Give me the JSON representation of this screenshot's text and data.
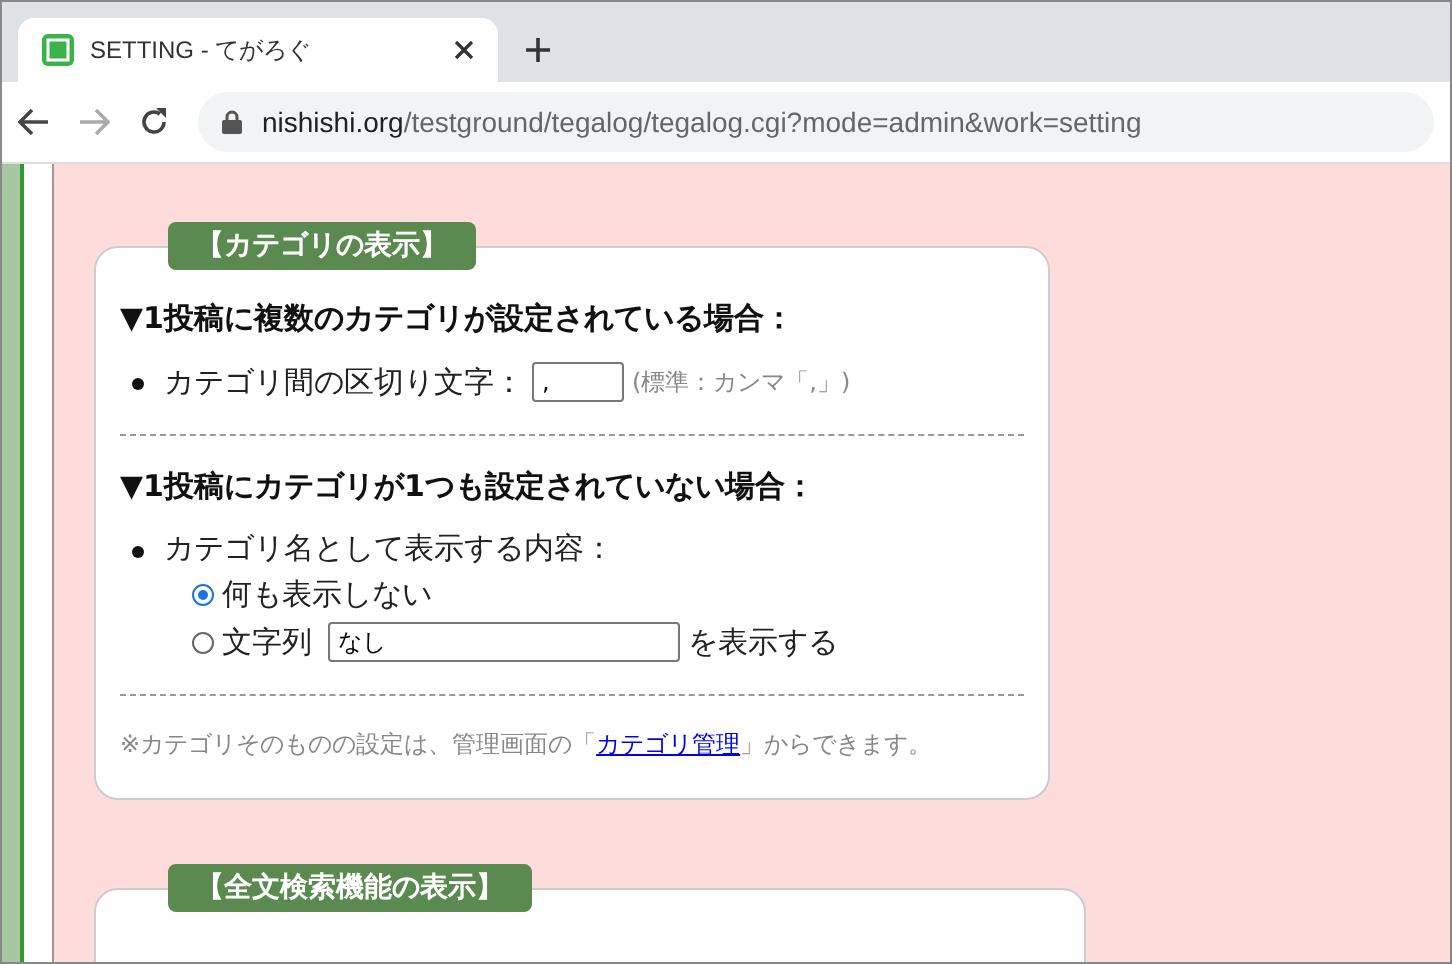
{
  "browser": {
    "tab_title": "SETTING - てがろぐ",
    "url_host": "nishishi.org",
    "url_path": "/testground/tegalog/tegalog.cgi?mode=admin&work=setting"
  },
  "sections": [
    {
      "title": "【カテゴリの表示】",
      "blocks": [
        {
          "heading": "▼1投稿に複数のカテゴリが設定されている場合：",
          "items": [
            {
              "kind": "text-input",
              "label": "カテゴリ間の区切り文字：",
              "value": ",",
              "note": "(標準：カンマ「,」)"
            }
          ]
        },
        {
          "heading": "▼1投稿にカテゴリが1つも設定されていない場合：",
          "items": [
            {
              "kind": "radio-group",
              "label": "カテゴリ名として表示する内容：",
              "options": [
                {
                  "label": "何も表示しない",
                  "selected": true
                },
                {
                  "label": "文字列",
                  "selected": false,
                  "value": "なし",
                  "suffix": "を表示する"
                }
              ]
            }
          ]
        }
      ],
      "footnote": {
        "before": "※カテゴリそのものの設定は、管理画面の「",
        "link": "カテゴリ管理",
        "after": "」からできます。"
      }
    },
    {
      "title": "【全文検索機能の表示】"
    }
  ]
}
